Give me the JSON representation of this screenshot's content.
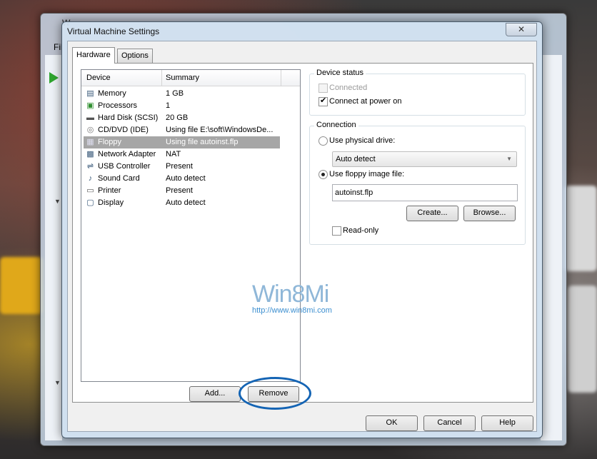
{
  "dialog": {
    "title": "Virtual Machine Settings",
    "close_glyph": "✕"
  },
  "back_window": {
    "title_partial": "W",
    "menu_partial": "Fil"
  },
  "tabs": [
    {
      "label": "Hardware",
      "active": true
    },
    {
      "label": "Options",
      "active": false
    }
  ],
  "device_list": {
    "headers": {
      "device": "Device",
      "summary": "Summary"
    },
    "rows": [
      {
        "name": "Memory",
        "summary": "1 GB",
        "icon": "memory-icon",
        "glyph": "▤"
      },
      {
        "name": "Processors",
        "summary": "1",
        "icon": "processor-icon",
        "glyph": "▣"
      },
      {
        "name": "Hard Disk (SCSI)",
        "summary": "20 GB",
        "icon": "hard-disk-icon",
        "glyph": "▬"
      },
      {
        "name": "CD/DVD (IDE)",
        "summary": "Using file E:\\soft\\WindowsDe...",
        "icon": "cd-dvd-icon",
        "glyph": "◎"
      },
      {
        "name": "Floppy",
        "summary": "Using file autoinst.flp",
        "icon": "floppy-icon",
        "glyph": "▦",
        "selected": true
      },
      {
        "name": "Network Adapter",
        "summary": "NAT",
        "icon": "network-adapter-icon",
        "glyph": "▩"
      },
      {
        "name": "USB Controller",
        "summary": "Present",
        "icon": "usb-icon",
        "glyph": "⇌"
      },
      {
        "name": "Sound Card",
        "summary": "Auto detect",
        "icon": "sound-card-icon",
        "glyph": "♪"
      },
      {
        "name": "Printer",
        "summary": "Present",
        "icon": "printer-icon",
        "glyph": "▭"
      },
      {
        "name": "Display",
        "summary": "Auto detect",
        "icon": "display-icon",
        "glyph": "▢"
      }
    ]
  },
  "buttons": {
    "add": "Add...",
    "remove": "Remove",
    "ok": "OK",
    "cancel": "Cancel",
    "help": "Help",
    "create": "Create...",
    "browse": "Browse..."
  },
  "device_status": {
    "label": "Device status",
    "connected": {
      "label": "Connected",
      "checked": false,
      "disabled": true
    },
    "connect_on_power": {
      "label": "Connect at power on",
      "checked": true
    }
  },
  "connection": {
    "label": "Connection",
    "use_physical": {
      "label": "Use physical drive:",
      "selected": false
    },
    "drive_select": {
      "value": "Auto detect"
    },
    "use_image": {
      "label": "Use floppy image file:",
      "selected": true
    },
    "image_file": {
      "value": "autoinst.flp"
    },
    "read_only": {
      "label": "Read-only",
      "checked": false
    }
  },
  "watermark": {
    "logo": "Win8Mi",
    "url": "http://www.win8mi.com"
  },
  "colors": {
    "accent_ring": "#1464b4",
    "selection": "#a6a6a6",
    "watermark": "#8fb7d8"
  }
}
